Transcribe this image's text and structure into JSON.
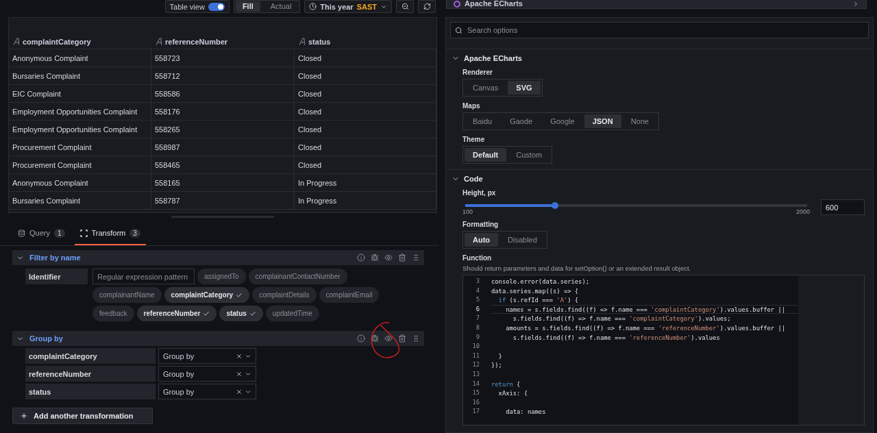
{
  "toolbar": {
    "table_view": {
      "label": "Table view",
      "on": true
    },
    "fill_options": [
      {
        "label": "Fill",
        "selected": true
      },
      {
        "label": "Actual",
        "selected": false
      }
    ],
    "time_range": {
      "label": "This year",
      "timezone": "SAST"
    }
  },
  "table": {
    "columns": [
      "complaintCategory",
      "referenceNumber",
      "status"
    ],
    "rows": [
      [
        "Anonymous Complaint",
        "558723",
        "Closed"
      ],
      [
        "Bursaries Complaint",
        "558712",
        "Closed"
      ],
      [
        "EIC Complaint",
        "558586",
        "Closed"
      ],
      [
        "Employment Opportunities Complaint",
        "558176",
        "Closed"
      ],
      [
        "Employment Opportunities Complaint",
        "558265",
        "Closed"
      ],
      [
        "Procurement Complaint",
        "558987",
        "Closed"
      ],
      [
        "Procurement Complaint",
        "558465",
        "Closed"
      ],
      [
        "Anonymous Complaint",
        "558165",
        "In Progress"
      ],
      [
        "Bursaries Complaint",
        "558787",
        "In Progress"
      ]
    ]
  },
  "tabs": [
    {
      "label": "Query",
      "count": "1",
      "selected": false
    },
    {
      "label": "Transform",
      "count": "3",
      "selected": true
    }
  ],
  "transformations": [
    {
      "kind": "filter",
      "title": "Filter by name",
      "expanded": true,
      "label": "Identifier",
      "placeholder": "Regular expression pattern",
      "fields": [
        {
          "name": "assignedTo",
          "selected": false
        },
        {
          "name": "complainantContactNumber",
          "selected": false
        },
        {
          "name": "complainantName",
          "selected": false
        },
        {
          "name": "complaintCategory",
          "selected": true
        },
        {
          "name": "complaintDetails",
          "selected": false
        },
        {
          "name": "complaintEmail",
          "selected": false
        },
        {
          "name": "feedback",
          "selected": false
        },
        {
          "name": "referenceNumber",
          "selected": true
        },
        {
          "name": "status",
          "selected": true
        },
        {
          "name": "updatedTime",
          "selected": false
        }
      ]
    },
    {
      "kind": "group",
      "title": "Group by",
      "expanded": true,
      "fields": [
        {
          "name": "complaintCategory",
          "value": "Group by"
        },
        {
          "name": "referenceNumber",
          "value": "Group by"
        },
        {
          "name": "status",
          "value": "Group by"
        }
      ]
    }
  ],
  "add_button": "Add another transformation",
  "visualization": {
    "name": "Apache ECharts"
  },
  "search": {
    "placeholder": "Search options"
  },
  "sections": [
    {
      "title": "Apache ECharts",
      "expanded": true,
      "options": [
        {
          "kind": "radio",
          "label": "Renderer",
          "choices": [
            {
              "label": "Canvas",
              "selected": false
            },
            {
              "label": "SVG",
              "selected": true
            }
          ]
        },
        {
          "kind": "radio",
          "label": "Maps",
          "choices": [
            {
              "label": "Baidu",
              "selected": false
            },
            {
              "label": "Gaode",
              "selected": false
            },
            {
              "label": "Google",
              "selected": false
            },
            {
              "label": "JSON",
              "selected": true
            },
            {
              "label": "None",
              "selected": false
            }
          ]
        },
        {
          "kind": "radio",
          "label": "Theme",
          "choices": [
            {
              "label": "Default",
              "selected": true
            },
            {
              "label": "Custom",
              "selected": false
            }
          ]
        }
      ]
    },
    {
      "title": "Code",
      "expanded": true,
      "options": [
        {
          "kind": "slider",
          "label": "Height, px",
          "level": 0.263,
          "min": "100",
          "max": "2000",
          "value": "600"
        },
        {
          "kind": "radio",
          "label": "Formatting",
          "choices": [
            {
              "label": "Auto",
              "selected": true
            },
            {
              "label": "Disabled",
              "selected": false
            }
          ]
        },
        {
          "kind": "code",
          "label": "Function",
          "description": "Should return parameters and data for setOption() or an extended result object.",
          "lines": [
            {
              "num": "3",
              "current": false,
              "tokens": [
                {
                  "kind": "plain",
                  "text": "console.error(data.series);"
                }
              ]
            },
            {
              "num": "4",
              "current": false,
              "tokens": [
                {
                  "kind": "plain",
                  "text": "data.series.map((s) => {"
                }
              ]
            },
            {
              "num": "5",
              "current": false,
              "tokens": [
                {
                  "kind": "keyword",
                  "text": "  if"
                },
                {
                  "kind": "plain",
                  "text": " (s.refId === "
                },
                {
                  "kind": "string",
                  "text": "'A'"
                },
                {
                  "kind": "plain",
                  "text": ") {"
                }
              ]
            },
            {
              "num": "6",
              "current": true,
              "tokens": [
                {
                  "kind": "plain",
                  "text": "    names = s.fields.find((f) => f.name === "
                },
                {
                  "kind": "string",
                  "text": "'complaintCategory'"
                },
                {
                  "kind": "plain",
                  "text": ").values.buffer ||"
                }
              ]
            },
            {
              "num": "7",
              "current": false,
              "tokens": [
                {
                  "kind": "plain",
                  "text": "      s.fields.find((f) => f.name === "
                },
                {
                  "kind": "string",
                  "text": "'complaintCategory'"
                },
                {
                  "kind": "plain",
                  "text": ").values;"
                }
              ]
            },
            {
              "num": "8",
              "current": false,
              "tokens": [
                {
                  "kind": "plain",
                  "text": "    amounts = s.fields.find((f) => f.name === "
                },
                {
                  "kind": "string",
                  "text": "'referenceNumber'"
                },
                {
                  "kind": "plain",
                  "text": ").values.buffer ||"
                }
              ]
            },
            {
              "num": "9",
              "current": false,
              "tokens": [
                {
                  "kind": "plain",
                  "text": "      s.fields.find((f) => f.name === "
                },
                {
                  "kind": "string",
                  "text": "'referenceNumber'"
                },
                {
                  "kind": "plain",
                  "text": ").values"
                }
              ]
            },
            {
              "num": "10",
              "current": false
            },
            {
              "num": "11",
              "current": false,
              "tokens": [
                {
                  "kind": "plain",
                  "text": "  }"
                }
              ]
            },
            {
              "num": "12",
              "current": false,
              "tokens": [
                {
                  "kind": "plain",
                  "text": "});"
                }
              ]
            },
            {
              "num": "13",
              "current": false
            },
            {
              "num": "14",
              "current": false,
              "tokens": [
                {
                  "kind": "keyword",
                  "text": "return"
                },
                {
                  "kind": "plain",
                  "text": " {"
                }
              ]
            },
            {
              "num": "15",
              "current": false,
              "tokens": [
                {
                  "kind": "plain",
                  "text": "  xAxis: {"
                }
              ]
            },
            {
              "num": "16",
              "current": false
            },
            {
              "num": "17",
              "current": false,
              "tokens": [
                {
                  "kind": "plain",
                  "text": "    data: names"
                }
              ]
            }
          ]
        }
      ]
    }
  ]
}
